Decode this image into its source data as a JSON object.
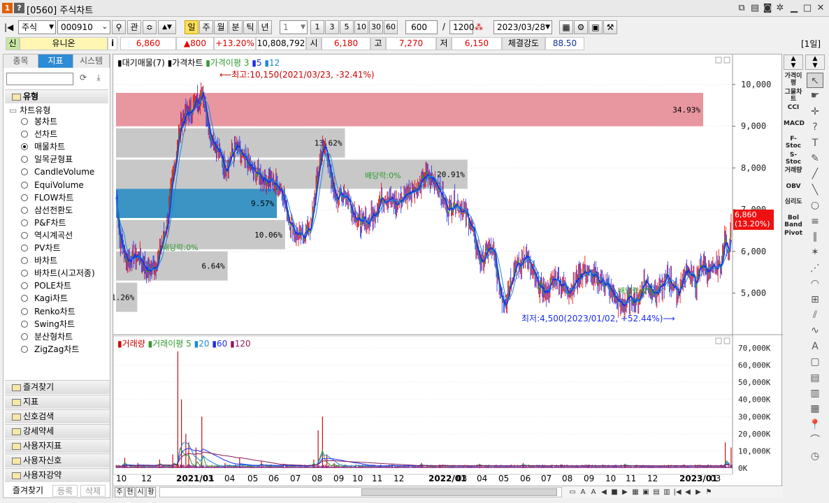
{
  "window": {
    "badge1": "1",
    "badge2": "?",
    "title": "[0560] 주식차트"
  },
  "toolbar": {
    "market": "주식",
    "code": "000910",
    "search_icon": "magnifier-icon",
    "gwan": "관",
    "periods": [
      "일",
      "주",
      "월",
      "분",
      "틱",
      "년"
    ],
    "period_selected": "일",
    "interval": "1",
    "quick": [
      "1",
      "3",
      "5",
      "10",
      "30",
      "60"
    ],
    "count": "600",
    "slash": "/",
    "total": "1200",
    "date": "2023/03/28"
  },
  "quote": {
    "sin": "신",
    "name": "유니온",
    "info": "i",
    "price": "6,860",
    "change": "▲800",
    "rate": "+13.20%",
    "volume": "10,808,792",
    "open_lbl": "시",
    "open": "6,180",
    "high_lbl": "고",
    "high": "7,270",
    "low_lbl": "저",
    "low": "6,150",
    "str_lbl": "체결강도",
    "str": "88.50",
    "period_badge": "[1일]"
  },
  "left": {
    "tabs": [
      "종목",
      "지표",
      "시스템"
    ],
    "tab_selected": "지표",
    "type_header": "유형",
    "chart_type_folder": "차트유형",
    "types": [
      "봉차트",
      "선차트",
      "매물차트",
      "일목균형표",
      "CandleVolume",
      "EquiVolume",
      "FLOW차트",
      "삼선전환도",
      "P&F차트",
      "역시계곡선",
      "PV차트",
      "바차트",
      "바차트(시고저종)",
      "POLE차트",
      "Kagi차트",
      "Renko차트",
      "Swing차트",
      "분산형차트",
      "ZigZag차트"
    ],
    "type_selected": "매물차트",
    "sections": [
      "즐겨찾기",
      "지표",
      "신호검색",
      "강세약세",
      "사용자지표",
      "사용자신호",
      "사용자강약"
    ],
    "bottom": [
      "즐겨찾기",
      "등록",
      "삭제"
    ]
  },
  "chart": {
    "legend_volprofile": "대기매물(7)",
    "legend_price": "가격차트",
    "legend_ma": "가격이평",
    "ma_periods": [
      "3",
      "5",
      "12"
    ],
    "high_note": "⟵최고:10,150(2021/03/23, -32.41%)",
    "low_note": "최저:4,500(2023/01/02, +52.44%)⟶",
    "div1": "배당락:0%",
    "div2": "배당락:0%",
    "div3": "배당락:0%",
    "price_tag": "6,860",
    "price_tag_pct": "(13.20%)",
    "profile": [
      {
        "price_low": 9000,
        "price_high": 9800,
        "pct": "34.93%",
        "color": "#e8969f"
      },
      {
        "price_low": 8250,
        "price_high": 8950,
        "pct": "13.62%",
        "color": "#c8c8c8"
      },
      {
        "price_low": 7500,
        "price_high": 8200,
        "pct": "20.91%",
        "color": "#c8c8c8"
      },
      {
        "price_low": 6800,
        "price_high": 7500,
        "pct": "9.57%",
        "color": "#3b94c3"
      },
      {
        "price_low": 6050,
        "price_high": 6750,
        "pct": "10.06%",
        "color": "#c8c8c8"
      },
      {
        "price_low": 5300,
        "price_high": 6000,
        "pct": "6.64%",
        "color": "#c8c8c8"
      },
      {
        "price_low": 4550,
        "price_high": 5250,
        "pct": "1.26%",
        "color": "#c8c8c8"
      }
    ],
    "y_ticks": [
      "10,000",
      "9,000",
      "8,000",
      "7,000",
      "6,000",
      "5,000"
    ],
    "vol_legend": "거래량",
    "vol_ma_legend": "거래이평",
    "vol_ma": [
      "5",
      "20",
      "60",
      "120"
    ],
    "vol_ticks": [
      "70,000K",
      "60,000K",
      "50,000K",
      "40,000K",
      "30,000K",
      "20,000K",
      "10,000K",
      "0K"
    ],
    "x_ticks": [
      "10",
      "12",
      "2021/01",
      "03",
      "04",
      "05",
      "06",
      "07",
      "08",
      "09",
      "10",
      "11",
      "12",
      "2022/01",
      "03",
      "04",
      "05",
      "06",
      "07",
      "08",
      "09",
      "10",
      "11",
      "12",
      "2023/01",
      "03"
    ],
    "bottom_btns": [
      "주",
      "현",
      "시",
      "황"
    ]
  },
  "right_tools": [
    "가격이평",
    "그물차트",
    "CCI",
    "MACD",
    "F-Stoc",
    "S-Stoc",
    "거래량",
    "OBV",
    "심리도",
    "Bol Band",
    "Pivot"
  ],
  "colors": {
    "up": "#e00000",
    "ma3": "#2e9a2e",
    "ma5": "#1a2cf0",
    "ma12": "#1a8ad6",
    "accent": "#2e8bd6",
    "price_tag": "#ee1111"
  },
  "chart_data": {
    "type": "candlestick",
    "title": "",
    "ylim": [
      4300,
      10500
    ],
    "price_path": [
      [
        0,
        7300
      ],
      [
        5,
        6300
      ],
      [
        15,
        5800
      ],
      [
        30,
        5900
      ],
      [
        45,
        5500
      ],
      [
        55,
        5700
      ],
      [
        62,
        6100
      ],
      [
        70,
        6700
      ],
      [
        78,
        7700
      ],
      [
        85,
        8700
      ],
      [
        92,
        9200
      ],
      [
        100,
        9300
      ],
      [
        110,
        9600
      ],
      [
        120,
        9800
      ],
      [
        128,
        8900
      ],
      [
        138,
        8500
      ],
      [
        150,
        8000
      ],
      [
        165,
        8500
      ],
      [
        175,
        8200
      ],
      [
        190,
        7900
      ],
      [
        200,
        7800
      ],
      [
        210,
        7700
      ],
      [
        220,
        7600
      ],
      [
        228,
        7500
      ],
      [
        235,
        6900
      ],
      [
        245,
        6500
      ],
      [
        255,
        6300
      ],
      [
        262,
        6500
      ],
      [
        268,
        6600
      ],
      [
        275,
        7500
      ],
      [
        282,
        8400
      ],
      [
        289,
        8500
      ],
      [
        296,
        7600
      ],
      [
        305,
        7300
      ],
      [
        315,
        7400
      ],
      [
        325,
        7000
      ],
      [
        335,
        6700
      ],
      [
        345,
        6700
      ],
      [
        355,
        6900
      ],
      [
        365,
        7300
      ],
      [
        375,
        7300
      ],
      [
        385,
        7100
      ],
      [
        395,
        7300
      ],
      [
        405,
        7500
      ],
      [
        415,
        7500
      ],
      [
        425,
        7800
      ],
      [
        440,
        7700
      ],
      [
        448,
        7300
      ],
      [
        458,
        7000
      ],
      [
        466,
        7200
      ],
      [
        476,
        7000
      ],
      [
        487,
        6700
      ],
      [
        494,
        6200
      ],
      [
        503,
        5700
      ],
      [
        513,
        6100
      ],
      [
        520,
        5900
      ],
      [
        526,
        5200
      ],
      [
        531,
        4900
      ],
      [
        536,
        4800
      ],
      [
        542,
        5300
      ],
      [
        550,
        5700
      ],
      [
        556,
        5600
      ],
      [
        563,
        6000
      ],
      [
        570,
        5600
      ],
      [
        580,
        5200
      ],
      [
        590,
        5000
      ],
      [
        597,
        5200
      ],
      [
        605,
        5400
      ],
      [
        614,
        5200
      ],
      [
        622,
        5100
      ],
      [
        630,
        5200
      ],
      [
        640,
        5500
      ],
      [
        647,
        5500
      ],
      [
        655,
        5400
      ],
      [
        663,
        5300
      ],
      [
        671,
        5300
      ],
      [
        678,
        5100
      ],
      [
        686,
        4900
      ],
      [
        694,
        4700
      ],
      [
        702,
        4800
      ],
      [
        710,
        4900
      ],
      [
        718,
        4800
      ],
      [
        726,
        5300
      ],
      [
        734,
        5200
      ],
      [
        742,
        5000
      ],
      [
        750,
        5100
      ],
      [
        758,
        5400
      ],
      [
        766,
        5200
      ],
      [
        772,
        5000
      ],
      [
        779,
        5300
      ],
      [
        786,
        5600
      ],
      [
        792,
        5400
      ],
      [
        798,
        5200
      ],
      [
        804,
        5700
      ],
      [
        811,
        5600
      ],
      [
        818,
        5500
      ],
      [
        826,
        5600
      ],
      [
        832,
        5700
      ],
      [
        838,
        6300
      ],
      [
        843,
        6000
      ],
      [
        846,
        6860
      ]
    ],
    "volume_spikes": [
      [
        12,
        6000
      ],
      [
        30,
        3000
      ],
      [
        60,
        5000
      ],
      [
        78,
        8000
      ],
      [
        85,
        68000
      ],
      [
        90,
        40000
      ],
      [
        96,
        20000
      ],
      [
        100,
        15000
      ],
      [
        110,
        12000
      ],
      [
        118,
        30000
      ],
      [
        150,
        3000
      ],
      [
        170,
        6000
      ],
      [
        200,
        4000
      ],
      [
        230,
        2500
      ],
      [
        272,
        5000
      ],
      [
        278,
        22000
      ],
      [
        284,
        30000
      ],
      [
        290,
        8000
      ],
      [
        300,
        3000
      ],
      [
        330,
        2000
      ],
      [
        380,
        2000
      ],
      [
        420,
        3000
      ],
      [
        445,
        2000
      ],
      [
        500,
        2500
      ],
      [
        560,
        3000
      ],
      [
        600,
        1500
      ],
      [
        650,
        2000
      ],
      [
        700,
        2500
      ],
      [
        760,
        1500
      ],
      [
        800,
        1500
      ],
      [
        838,
        15000
      ],
      [
        846,
        12000
      ]
    ],
    "volume_ylim": [
      0,
      73000
    ]
  }
}
